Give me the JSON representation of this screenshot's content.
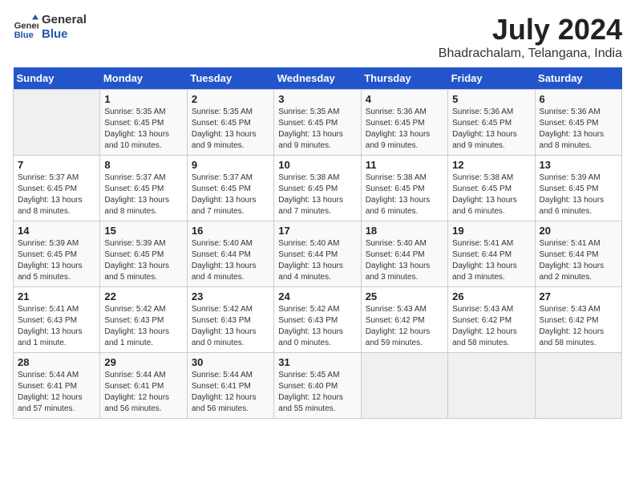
{
  "logo": {
    "line1": "General",
    "line2": "Blue"
  },
  "title": "July 2024",
  "subtitle": "Bhadrachalam, Telangana, India",
  "days_of_week": [
    "Sunday",
    "Monday",
    "Tuesday",
    "Wednesday",
    "Thursday",
    "Friday",
    "Saturday"
  ],
  "weeks": [
    [
      {
        "day": "",
        "info": ""
      },
      {
        "day": "1",
        "info": "Sunrise: 5:35 AM\nSunset: 6:45 PM\nDaylight: 13 hours\nand 10 minutes."
      },
      {
        "day": "2",
        "info": "Sunrise: 5:35 AM\nSunset: 6:45 PM\nDaylight: 13 hours\nand 9 minutes."
      },
      {
        "day": "3",
        "info": "Sunrise: 5:35 AM\nSunset: 6:45 PM\nDaylight: 13 hours\nand 9 minutes."
      },
      {
        "day": "4",
        "info": "Sunrise: 5:36 AM\nSunset: 6:45 PM\nDaylight: 13 hours\nand 9 minutes."
      },
      {
        "day": "5",
        "info": "Sunrise: 5:36 AM\nSunset: 6:45 PM\nDaylight: 13 hours\nand 9 minutes."
      },
      {
        "day": "6",
        "info": "Sunrise: 5:36 AM\nSunset: 6:45 PM\nDaylight: 13 hours\nand 8 minutes."
      }
    ],
    [
      {
        "day": "7",
        "info": "Sunrise: 5:37 AM\nSunset: 6:45 PM\nDaylight: 13 hours\nand 8 minutes."
      },
      {
        "day": "8",
        "info": "Sunrise: 5:37 AM\nSunset: 6:45 PM\nDaylight: 13 hours\nand 8 minutes."
      },
      {
        "day": "9",
        "info": "Sunrise: 5:37 AM\nSunset: 6:45 PM\nDaylight: 13 hours\nand 7 minutes."
      },
      {
        "day": "10",
        "info": "Sunrise: 5:38 AM\nSunset: 6:45 PM\nDaylight: 13 hours\nand 7 minutes."
      },
      {
        "day": "11",
        "info": "Sunrise: 5:38 AM\nSunset: 6:45 PM\nDaylight: 13 hours\nand 6 minutes."
      },
      {
        "day": "12",
        "info": "Sunrise: 5:38 AM\nSunset: 6:45 PM\nDaylight: 13 hours\nand 6 minutes."
      },
      {
        "day": "13",
        "info": "Sunrise: 5:39 AM\nSunset: 6:45 PM\nDaylight: 13 hours\nand 6 minutes."
      }
    ],
    [
      {
        "day": "14",
        "info": "Sunrise: 5:39 AM\nSunset: 6:45 PM\nDaylight: 13 hours\nand 5 minutes."
      },
      {
        "day": "15",
        "info": "Sunrise: 5:39 AM\nSunset: 6:45 PM\nDaylight: 13 hours\nand 5 minutes."
      },
      {
        "day": "16",
        "info": "Sunrise: 5:40 AM\nSunset: 6:44 PM\nDaylight: 13 hours\nand 4 minutes."
      },
      {
        "day": "17",
        "info": "Sunrise: 5:40 AM\nSunset: 6:44 PM\nDaylight: 13 hours\nand 4 minutes."
      },
      {
        "day": "18",
        "info": "Sunrise: 5:40 AM\nSunset: 6:44 PM\nDaylight: 13 hours\nand 3 minutes."
      },
      {
        "day": "19",
        "info": "Sunrise: 5:41 AM\nSunset: 6:44 PM\nDaylight: 13 hours\nand 3 minutes."
      },
      {
        "day": "20",
        "info": "Sunrise: 5:41 AM\nSunset: 6:44 PM\nDaylight: 13 hours\nand 2 minutes."
      }
    ],
    [
      {
        "day": "21",
        "info": "Sunrise: 5:41 AM\nSunset: 6:43 PM\nDaylight: 13 hours\nand 1 minute."
      },
      {
        "day": "22",
        "info": "Sunrise: 5:42 AM\nSunset: 6:43 PM\nDaylight: 13 hours\nand 1 minute."
      },
      {
        "day": "23",
        "info": "Sunrise: 5:42 AM\nSunset: 6:43 PM\nDaylight: 13 hours\nand 0 minutes."
      },
      {
        "day": "24",
        "info": "Sunrise: 5:42 AM\nSunset: 6:43 PM\nDaylight: 13 hours\nand 0 minutes."
      },
      {
        "day": "25",
        "info": "Sunrise: 5:43 AM\nSunset: 6:42 PM\nDaylight: 12 hours\nand 59 minutes."
      },
      {
        "day": "26",
        "info": "Sunrise: 5:43 AM\nSunset: 6:42 PM\nDaylight: 12 hours\nand 58 minutes."
      },
      {
        "day": "27",
        "info": "Sunrise: 5:43 AM\nSunset: 6:42 PM\nDaylight: 12 hours\nand 58 minutes."
      }
    ],
    [
      {
        "day": "28",
        "info": "Sunrise: 5:44 AM\nSunset: 6:41 PM\nDaylight: 12 hours\nand 57 minutes."
      },
      {
        "day": "29",
        "info": "Sunrise: 5:44 AM\nSunset: 6:41 PM\nDaylight: 12 hours\nand 56 minutes."
      },
      {
        "day": "30",
        "info": "Sunrise: 5:44 AM\nSunset: 6:41 PM\nDaylight: 12 hours\nand 56 minutes."
      },
      {
        "day": "31",
        "info": "Sunrise: 5:45 AM\nSunset: 6:40 PM\nDaylight: 12 hours\nand 55 minutes."
      },
      {
        "day": "",
        "info": ""
      },
      {
        "day": "",
        "info": ""
      },
      {
        "day": "",
        "info": ""
      }
    ]
  ]
}
